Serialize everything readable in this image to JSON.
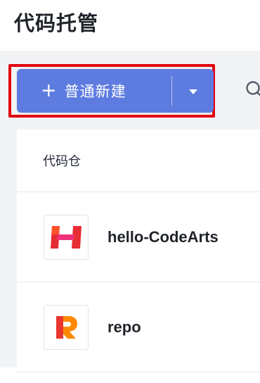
{
  "page": {
    "title": "代码托管"
  },
  "toolbar": {
    "create_button_label": "普通新建",
    "create_plus_glyph": "+"
  },
  "repo_list": {
    "column_header": "代码仓",
    "rows": [
      {
        "name": "hello-CodeArts",
        "logo": "codearts-h-logo"
      },
      {
        "name": "repo",
        "logo": "codearts-r-logo"
      }
    ]
  },
  "colors": {
    "primary_button": "#5e7ce0",
    "highlight_frame": "#e30010",
    "toolbar_background": "#f2f3f5",
    "logo_red": "#e62d33",
    "logo_pink": "#f0327a",
    "logo_orange": "#ff8a00"
  }
}
